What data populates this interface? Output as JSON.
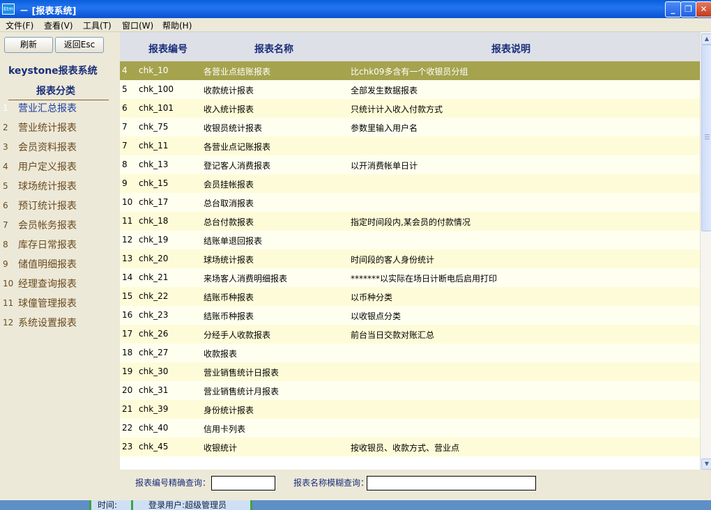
{
  "window": {
    "icon_text": "Etm",
    "title": "－ [报表系统]",
    "controls": {
      "minimize": "_",
      "restore": "❐",
      "close": "✕"
    }
  },
  "menu": [
    "文件(F)",
    "查看(V)",
    "工具(T)",
    "窗口(W)",
    "帮助(H)"
  ],
  "left": {
    "refresh_label": "刷新",
    "back_label": "返回Esc",
    "brand": "keystone报表系统",
    "category_title": "报表分类",
    "categories": [
      {
        "num": "1",
        "label": "营业汇总报表"
      },
      {
        "num": "2",
        "label": "营业统计报表"
      },
      {
        "num": "3",
        "label": "会员资料报表"
      },
      {
        "num": "4",
        "label": "用户定义报表"
      },
      {
        "num": "5",
        "label": "球场统计报表"
      },
      {
        "num": "6",
        "label": "预订统计报表"
      },
      {
        "num": "7",
        "label": "会员帐务报表"
      },
      {
        "num": "8",
        "label": "库存日常报表"
      },
      {
        "num": "9",
        "label": "储值明细报表"
      },
      {
        "num": "10",
        "label": "经理查询报表"
      },
      {
        "num": "11",
        "label": "球僮管理报表"
      },
      {
        "num": "12",
        "label": "系统设置报表"
      }
    ]
  },
  "grid": {
    "headers": [
      "报表编号",
      "报表名称",
      "报表说明"
    ],
    "rows": [
      [
        "4",
        "chk_10",
        "各营业点结账报表",
        "比chk09多含有一个收银员分组"
      ],
      [
        "5",
        "chk_100",
        "收款统计报表",
        "全部发生数据报表"
      ],
      [
        "6",
        "chk_101",
        "收入统计报表",
        "只统计计入收入付款方式"
      ],
      [
        "7",
        "chk_75",
        "收银员统计报表",
        "参数里输入用户名"
      ],
      [
        "7",
        "chk_11",
        "各营业点记账报表",
        ""
      ],
      [
        "8",
        "chk_13",
        "登记客人消费报表",
        "以开消费帐单日计"
      ],
      [
        "9",
        "chk_15",
        "会员挂帐报表",
        ""
      ],
      [
        "10",
        "chk_17",
        "总台取消报表",
        ""
      ],
      [
        "11",
        "chk_18",
        "总台付款报表",
        "指定时间段内,某会员的付款情况"
      ],
      [
        "12",
        "chk_19",
        "结账单退回报表",
        ""
      ],
      [
        "13",
        "chk_20",
        "球场统计报表",
        "时间段的客人身份统计"
      ],
      [
        "14",
        "chk_21",
        "来场客人消费明细报表",
        "*******以实际在场日计断电后启用打印"
      ],
      [
        "15",
        "chk_22",
        "结账币种报表",
        "以币种分类"
      ],
      [
        "16",
        "chk_23",
        "结账币种报表",
        "以收银点分类"
      ],
      [
        "17",
        "chk_26",
        "分经手人收款报表",
        "前台当日交款对账汇总"
      ],
      [
        "18",
        "chk_27",
        "收款报表",
        ""
      ],
      [
        "19",
        "chk_30",
        "营业销售统计日报表",
        ""
      ],
      [
        "20",
        "chk_31",
        "营业销售统计月报表",
        ""
      ],
      [
        "21",
        "chk_39",
        "身份统计报表",
        ""
      ],
      [
        "22",
        "chk_40",
        "信用卡列表",
        ""
      ],
      [
        "23",
        "chk_45",
        "收银统计",
        "按收银员、收款方式、营业点"
      ]
    ],
    "selected_index": 0
  },
  "search": {
    "code_label": "报表编号精确查询：",
    "code_value": "",
    "name_label": "报表名称模糊查询：",
    "name_value": ""
  },
  "status": {
    "time_label": "时间:",
    "user_label": "登录用户:超级管理员"
  },
  "colors": {
    "selected_row": "#a6a34e",
    "header_text": "#1a2e7a",
    "category_text": "#6b4a1f"
  }
}
